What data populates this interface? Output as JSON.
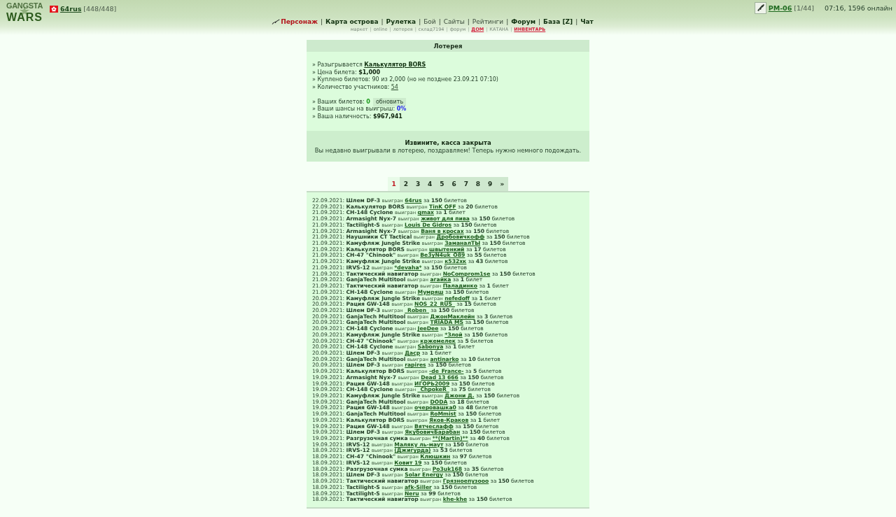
{
  "header": {
    "logo": {
      "top": "GANGSTA",
      "bottom": "WARS"
    },
    "user": {
      "name": "64rus",
      "health": "[448/448]"
    },
    "weapon": {
      "name": "PM-06",
      "ammo": "[1/44]"
    },
    "status": "07:16, 1596 онлайн"
  },
  "nav": {
    "main": [
      {
        "label": "Персонаж",
        "kind": "accent"
      },
      {
        "separator": "|",
        "label": "Карта острова",
        "kind": "bold"
      },
      {
        "separator": "|",
        "label": "Рулетка",
        "kind": "bold"
      },
      {
        "separator": "|",
        "label": "Бой",
        "kind": "plain"
      },
      {
        "separator": "|",
        "label": "Сайты",
        "kind": "plain"
      },
      {
        "separator": "|",
        "label": "Рейтинги",
        "kind": "plain"
      },
      {
        "separator": "|",
        "label": "Форум",
        "kind": "bold"
      },
      {
        "separator": "|",
        "label": "База [Z]",
        "kind": "bold"
      },
      {
        "separator": "|",
        "label": "Чат",
        "kind": "bold"
      }
    ],
    "sub": [
      {
        "label": "маркет",
        "kind": "plain"
      },
      {
        "separator": "|",
        "label": "online",
        "kind": "plain"
      },
      {
        "separator": "|",
        "label": "лотерея",
        "kind": "plain"
      },
      {
        "separator": "|",
        "label": "склад7194",
        "kind": "plain"
      },
      {
        "separator": "|",
        "label": "форум",
        "kind": "plain"
      },
      {
        "separator": "|",
        "label": "ДОМ",
        "kind": "alert"
      },
      {
        "separator": "|",
        "label": "КАТАНА",
        "kind": "plain"
      },
      {
        "separator": "|",
        "label": "ИНВЕНТАРЬ",
        "kind": "alert"
      }
    ]
  },
  "lottery": {
    "title": "Лотерея",
    "details": [
      {
        "kind": "link-bold",
        "label": "» Разыгрывается",
        "value": "Калькулятор BORS"
      },
      {
        "kind": "bold",
        "label": "» Цена билета:",
        "value": "$1,000"
      },
      {
        "kind": "text",
        "label": "» Куплено билетов: 90 из 2,000 (но не позднее 23.09.21 07:10)"
      },
      {
        "kind": "link",
        "label": "» Количество участников:",
        "value": "54"
      }
    ],
    "player": [
      {
        "kind": "tickets",
        "label": "» Ваших билетов:",
        "value": "0",
        "button": "обновить"
      },
      {
        "kind": "chance",
        "label": "» Ваши шансы на выигрыш:",
        "value": "0%"
      },
      {
        "kind": "bold",
        "label": "» Ваша наличность:",
        "value": "$967,941"
      }
    ],
    "notice": {
      "title": "Извините, касса закрыта",
      "message": "Вы недавно выигрывали в лотерею, поздравляем! Теперь нужно немного подождать."
    }
  },
  "pager": {
    "pages": [
      {
        "label": "1",
        "selected": true
      },
      {
        "label": "2",
        "selected": false
      },
      {
        "label": "3",
        "selected": false
      },
      {
        "label": "4",
        "selected": false
      },
      {
        "label": "5",
        "selected": false
      },
      {
        "label": "6",
        "selected": false
      },
      {
        "label": "7",
        "selected": false
      },
      {
        "label": "8",
        "selected": false
      },
      {
        "label": "9",
        "selected": false
      },
      {
        "label": "»",
        "selected": false
      }
    ]
  },
  "history": [
    {
      "date": "22.09.2021:",
      "item": "Шлем DF-3",
      "verb": "выигран",
      "winner": "64rus",
      "for": "за",
      "count": "150",
      "unit": "билетов"
    },
    {
      "date": "22.09.2021:",
      "item": "Калькулятор BORS",
      "verb": "выигран",
      "winner": "TinK OFF",
      "for": "за",
      "count": "20",
      "unit": "билетов"
    },
    {
      "date": "21.09.2021:",
      "item": "CH-148 Cyclone",
      "verb": "выигран",
      "winner": "qmax",
      "for": "за",
      "count": "1",
      "unit": "билет"
    },
    {
      "date": "21.09.2021:",
      "item": "Armasight Nyx-7",
      "verb": "выигран",
      "winner": "живот для пива",
      "for": "за",
      "count": "150",
      "unit": "билетов"
    },
    {
      "date": "21.09.2021:",
      "item": "Tactilight-S",
      "verb": "выигран",
      "winner": "Louis De Gidros",
      "for": "за",
      "count": "150",
      "unit": "билетов"
    },
    {
      "date": "21.09.2021:",
      "item": "Armasight Nyx-7",
      "verb": "выигран",
      "winner": "Ваня в кросах",
      "for": "за",
      "count": "150",
      "unit": "билетов"
    },
    {
      "date": "21.09.2021:",
      "item": "Наушники CT Tactical",
      "verb": "выигран",
      "winner": "Дробовичкофф",
      "for": "за",
      "count": "150",
      "unit": "билетов"
    },
    {
      "date": "21.09.2021:",
      "item": "Камуфляж Jungle Strike",
      "verb": "выигран",
      "winner": "ЗаманалТЫ",
      "for": "за",
      "count": "150",
      "unit": "билетов"
    },
    {
      "date": "21.09.2021:",
      "item": "Калькулятор BORS",
      "verb": "выигран",
      "winner": "швытенкий",
      "for": "за",
      "count": "17",
      "unit": "билетов"
    },
    {
      "date": "21.09.2021:",
      "item": "CH-47 \"Chinook\"",
      "verb": "выигран",
      "winner": "Be3yN4uk_O89",
      "for": "за",
      "count": "55",
      "unit": "билетов"
    },
    {
      "date": "21.09.2021:",
      "item": "Камуфляж Jungle Strike",
      "verb": "выигран",
      "winner": "к532хк",
      "for": "за",
      "count": "43",
      "unit": "билетов"
    },
    {
      "date": "21.09.2021:",
      "item": "IRVS-12",
      "verb": "выигран",
      "winner": "*devaha*",
      "for": "за",
      "count": "150",
      "unit": "билетов"
    },
    {
      "date": "21.09.2021:",
      "item": "Тактический навигатор",
      "verb": "выигран",
      "winner": "NoComprom1se",
      "for": "за",
      "count": "150",
      "unit": "билетов"
    },
    {
      "date": "21.09.2021:",
      "item": "GanjaTech Multitool",
      "verb": "выигран",
      "winner": "агайка",
      "for": "за",
      "count": "1",
      "unit": "билет"
    },
    {
      "date": "21.09.2021:",
      "item": "Тактический навигатор",
      "verb": "выигран",
      "winner": "Паладинко",
      "for": "за",
      "count": "1",
      "unit": "билет"
    },
    {
      "date": "21.09.2021:",
      "item": "CH-148 Cyclone",
      "verb": "выигран",
      "winner": "Мумряш",
      "for": "за",
      "count": "150",
      "unit": "билетов"
    },
    {
      "date": "20.09.2021:",
      "item": "Камуфляж Jungle Strike",
      "verb": "выигран",
      "winner": "nefedoff",
      "for": "за",
      "count": "1",
      "unit": "билет"
    },
    {
      "date": "20.09.2021:",
      "item": "Рация GW-148",
      "verb": "выигран",
      "winner": "NOS_22_RUS_",
      "for": "за",
      "count": "15",
      "unit": "билетов"
    },
    {
      "date": "20.09.2021:",
      "item": "Шлем DF-3",
      "verb": "выигран",
      "winner": "_Roben_",
      "for": "за",
      "count": "150",
      "unit": "билетов"
    },
    {
      "date": "20.09.2021:",
      "item": "GanjaTech Multitool",
      "verb": "выигран",
      "winner": "ДжонМаклейн",
      "for": "за",
      "count": "3",
      "unit": "билетов"
    },
    {
      "date": "20.09.2021:",
      "item": "GanjaTech Multitool",
      "verb": "выигран",
      "winner": "TRIADA MS",
      "for": "за",
      "count": "150",
      "unit": "билетов"
    },
    {
      "date": "20.09.2021:",
      "item": "CH-148 Cyclone",
      "verb": "выигран",
      "winner": "JeeDee",
      "for": "за",
      "count": "150",
      "unit": "билетов"
    },
    {
      "date": "20.09.2021:",
      "item": "Камуфляж Jungle Strike",
      "verb": "выигран",
      "winner": "*Злой",
      "for": "за",
      "count": "150",
      "unit": "билетов"
    },
    {
      "date": "20.09.2021:",
      "item": "CH-47 \"Chinook\"",
      "verb": "выигран",
      "winner": "кржемелек",
      "for": "за",
      "count": "5",
      "unit": "билетов"
    },
    {
      "date": "20.09.2021:",
      "item": "CH-148 Cyclone",
      "verb": "выигран",
      "winner": "Sabonya",
      "for": "за",
      "count": "1",
      "unit": "билет"
    },
    {
      "date": "20.09.2021:",
      "item": "Шлем DF-3",
      "verb": "выигран",
      "winner": "Даср",
      "for": "за",
      "count": "1",
      "unit": "билет"
    },
    {
      "date": "20.09.2021:",
      "item": "GanjaTech Multitool",
      "verb": "выигран",
      "winner": "antinarko",
      "for": "за",
      "count": "10",
      "unit": "билетов"
    },
    {
      "date": "20.09.2021:",
      "item": "Шлем DF-3",
      "verb": "выигран",
      "winner": "rapires",
      "for": "за",
      "count": "150",
      "unit": "билетов"
    },
    {
      "date": "19.09.2021:",
      "item": "Калькулятор BORS",
      "verb": "выигран",
      "winner": "-de_France-",
      "for": "за",
      "count": "5",
      "unit": "билетов"
    },
    {
      "date": "19.09.2021:",
      "item": "Armasight Nyx-7",
      "verb": "выигран",
      "winner": "Dead 13 666",
      "for": "за",
      "count": "150",
      "unit": "билетов"
    },
    {
      "date": "19.09.2021:",
      "item": "Рация GW-148",
      "verb": "выигран",
      "winner": "ИГОРЬ2009",
      "for": "за",
      "count": "150",
      "unit": "билетов"
    },
    {
      "date": "19.09.2021:",
      "item": "CH-148 Cyclone",
      "verb": "выигран",
      "winner": "_ChpokeR_",
      "for": "за",
      "count": "75",
      "unit": "билетов"
    },
    {
      "date": "19.09.2021:",
      "item": "Камуфляж Jungle Strike",
      "verb": "выигран",
      "winner": "Джони Д.",
      "for": "за",
      "count": "150",
      "unit": "билетов"
    },
    {
      "date": "19.09.2021:",
      "item": "GanjaTech Multitool",
      "verb": "выигран",
      "winner": "DODA",
      "for": "за",
      "count": "18",
      "unit": "билетов"
    },
    {
      "date": "19.09.2021:",
      "item": "Рация GW-148",
      "verb": "выигран",
      "winner": "очеровашка0",
      "for": "за",
      "count": "48",
      "unit": "билетов"
    },
    {
      "date": "19.09.2021:",
      "item": "GanjaTech Multitool",
      "verb": "выигран",
      "winner": "RoMmist",
      "for": "за",
      "count": "150",
      "unit": "билетов"
    },
    {
      "date": "19.09.2021:",
      "item": "Калькулятор BORS",
      "verb": "выигран",
      "winner": "Яков-Краков",
      "for": "за",
      "count": "1",
      "unit": "билет"
    },
    {
      "date": "19.09.2021:",
      "item": "Рация GW-148",
      "verb": "выигран",
      "winner": "Вятчеслафф",
      "for": "за",
      "count": "150",
      "unit": "билетов"
    },
    {
      "date": "19.09.2021:",
      "item": "Шлем DF-3",
      "verb": "выигран",
      "winner": "ЯкубовичБарабан",
      "for": "за",
      "count": "150",
      "unit": "билетов"
    },
    {
      "date": "19.09.2021:",
      "item": "Разгрузочная сумка",
      "verb": "выигран",
      "winner": "**(Martin)**",
      "for": "за",
      "count": "40",
      "unit": "билетов"
    },
    {
      "date": "19.09.2021:",
      "item": "IRVS-12",
      "verb": "выигран",
      "winner": "Маляку ль-маут",
      "for": "за",
      "count": "150",
      "unit": "билетов"
    },
    {
      "date": "18.09.2021:",
      "item": "IRVS-12",
      "verb": "выигран",
      "winner": "(Джигурда)",
      "for": "за",
      "count": "53",
      "unit": "билетов"
    },
    {
      "date": "18.09.2021:",
      "item": "CH-47 \"Chinook\"",
      "verb": "выигран",
      "winner": "Клюшкин",
      "for": "за",
      "count": "97",
      "unit": "билетов"
    },
    {
      "date": "18.09.2021:",
      "item": "IRVS-12",
      "verb": "выигран",
      "winner": "Ковит 19",
      "for": "за",
      "count": "150",
      "unit": "билетов"
    },
    {
      "date": "18.09.2021:",
      "item": "Разгрузочная сумка",
      "verb": "выигран",
      "winner": "Po3uk168",
      "for": "за",
      "count": "35",
      "unit": "билетов"
    },
    {
      "date": "18.09.2021:",
      "item": "Шлем DF-3",
      "verb": "выигран",
      "winner": "Solar Energy",
      "for": "за",
      "count": "150",
      "unit": "билетов"
    },
    {
      "date": "18.09.2021:",
      "item": "Тактический навигатор",
      "verb": "выигран",
      "winner": "Грязноепузооо",
      "for": "за",
      "count": "150",
      "unit": "билетов"
    },
    {
      "date": "18.09.2021:",
      "item": "Tactilight-S",
      "verb": "выигран",
      "winner": "afk-Siller",
      "for": "за",
      "count": "150",
      "unit": "билетов"
    },
    {
      "date": "18.09.2021:",
      "item": "Tactilight-S",
      "verb": "выигран",
      "winner": "Neru",
      "for": "за",
      "count": "99",
      "unit": "билетов"
    },
    {
      "date": "18.09.2021:",
      "item": "Тактический навигатор",
      "verb": "выигран",
      "winner": "khe-khe",
      "for": "за",
      "count": "150",
      "unit": "билетов"
    }
  ]
}
